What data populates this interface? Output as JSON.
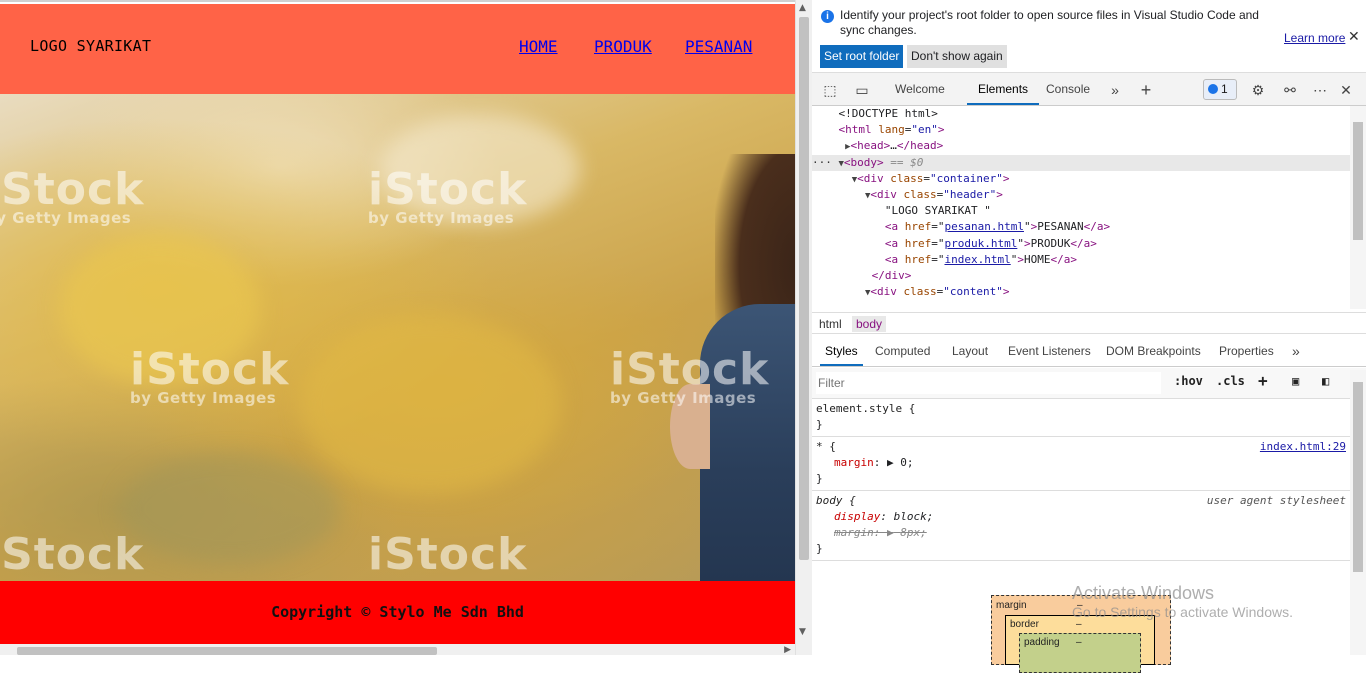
{
  "page": {
    "logo": "LOGO SYARIKAT",
    "nav": {
      "home": "HOME",
      "produk": "PRODUK",
      "pesanan": "PESANAN"
    },
    "watermark_main": "iStock",
    "watermark_sub": "by Getty Images",
    "footer": "Copyright © Stylo Me Sdn Bhd",
    "colors": {
      "header_bg": "#ff6347",
      "footer_bg": "#ff0000",
      "link": "#0000ee"
    }
  },
  "devtools": {
    "infobar": {
      "message": "Identify your project's root folder to open source files in Visual Studio Code and sync changes.",
      "learn_more": "Learn more",
      "set_root": "Set root folder",
      "dont_show": "Don't show again"
    },
    "tabs": {
      "welcome": "Welcome",
      "elements": "Elements",
      "console": "Console",
      "issues_count": "1"
    },
    "dom": {
      "doctype": "<!DOCTYPE html>",
      "html_tag": "html",
      "html_attr": "lang",
      "html_val": "\"en\"",
      "head": "head",
      "body": "body",
      "body_eq": "== $0",
      "div": "div",
      "class_attr": "class",
      "container_val": "\"container\"",
      "header_val": "\"header\"",
      "content_val": "\"content\"",
      "logo_text": "\"LOGO SYARIKAT \"",
      "a": "a",
      "href": "href",
      "pesanan_href": "pesanan.html",
      "produk_href": "produk.html",
      "index_href": "index.html",
      "pesanan_text": "PESANAN",
      "produk_text": "PRODUK",
      "home_text": "HOME"
    },
    "breadcrumbs": [
      "html",
      "body"
    ],
    "subtabs": [
      "Styles",
      "Computed",
      "Layout",
      "Event Listeners",
      "DOM Breakpoints",
      "Properties"
    ],
    "filter_placeholder": "Filter",
    "filter_hov": ":hov",
    "filter_cls": ".cls",
    "styles": {
      "element_style": "element.style {",
      "close_brace": "}",
      "universal_selector": "* {",
      "universal_source": "index.html:29",
      "margin_prop": "margin",
      "margin_val": "0;",
      "body_selector": "body {",
      "body_source": "user agent stylesheet",
      "display_prop": "display",
      "display_val": "block;",
      "body_margin_val": "8px;"
    },
    "boxmodel": {
      "margin": "margin",
      "border": "border",
      "padding": "padding",
      "dash": "–"
    },
    "activate": {
      "title": "Activate Windows",
      "subtitle": "Go to Settings to activate Windows."
    }
  }
}
